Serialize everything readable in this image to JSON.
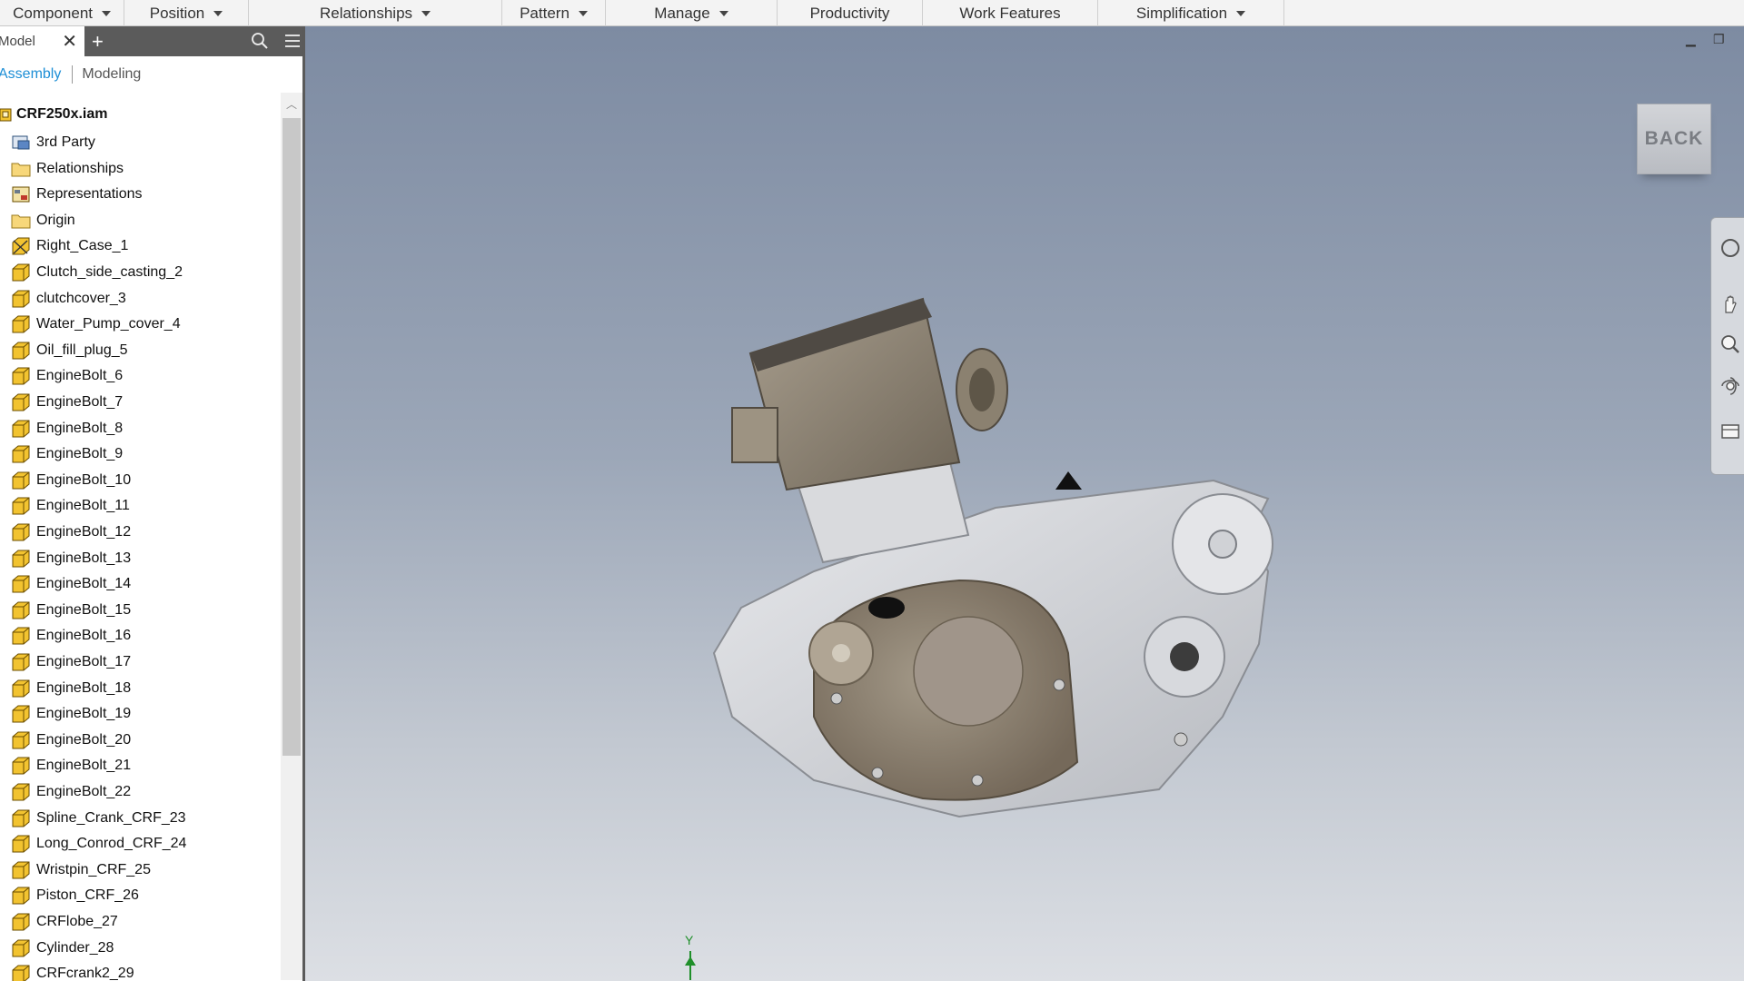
{
  "ribbon": {
    "tabs": [
      {
        "label": "Component",
        "dropdown": true
      },
      {
        "label": "Position",
        "dropdown": true
      },
      {
        "label": "Relationships",
        "dropdown": true
      },
      {
        "label": "Pattern",
        "dropdown": true
      },
      {
        "label": "Manage",
        "dropdown": true
      },
      {
        "label": "Productivity",
        "dropdown": false
      },
      {
        "label": "Work Features",
        "dropdown": false
      },
      {
        "label": "Simplification",
        "dropdown": true
      }
    ]
  },
  "browser": {
    "tab_label": "Model",
    "add_symbol": "+",
    "subtabs": {
      "active": "Assembly",
      "inactive": "Modeling"
    },
    "root": "CRF250x.iam",
    "items": [
      {
        "label": "3rd Party",
        "icon": "third-party-icon"
      },
      {
        "label": "Relationships",
        "icon": "folder-icon"
      },
      {
        "label": "Representations",
        "icon": "representations-icon"
      },
      {
        "label": "Origin",
        "icon": "folder-icon"
      },
      {
        "label": "Right_Case_1",
        "icon": "grounded-part-icon"
      },
      {
        "label": "Clutch_side_casting_2",
        "icon": "part-icon"
      },
      {
        "label": "clutchcover_3",
        "icon": "part-icon"
      },
      {
        "label": "Water_Pump_cover_4",
        "icon": "part-icon"
      },
      {
        "label": "Oil_fill_plug_5",
        "icon": "part-icon"
      },
      {
        "label": "EngineBolt_6",
        "icon": "part-icon"
      },
      {
        "label": "EngineBolt_7",
        "icon": "part-icon"
      },
      {
        "label": "EngineBolt_8",
        "icon": "part-icon"
      },
      {
        "label": "EngineBolt_9",
        "icon": "part-icon"
      },
      {
        "label": "EngineBolt_10",
        "icon": "part-icon"
      },
      {
        "label": "EngineBolt_11",
        "icon": "part-icon"
      },
      {
        "label": "EngineBolt_12",
        "icon": "part-icon"
      },
      {
        "label": "EngineBolt_13",
        "icon": "part-icon"
      },
      {
        "label": "EngineBolt_14",
        "icon": "part-icon"
      },
      {
        "label": "EngineBolt_15",
        "icon": "part-icon"
      },
      {
        "label": "EngineBolt_16",
        "icon": "part-icon"
      },
      {
        "label": "EngineBolt_17",
        "icon": "part-icon"
      },
      {
        "label": "EngineBolt_18",
        "icon": "part-icon"
      },
      {
        "label": "EngineBolt_19",
        "icon": "part-icon"
      },
      {
        "label": "EngineBolt_20",
        "icon": "part-icon"
      },
      {
        "label": "EngineBolt_21",
        "icon": "part-icon"
      },
      {
        "label": "EngineBolt_22",
        "icon": "part-icon"
      },
      {
        "label": "Spline_Crank_CRF_23",
        "icon": "part-icon"
      },
      {
        "label": "Long_Conrod_CRF_24",
        "icon": "part-icon"
      },
      {
        "label": "Wristpin_CRF_25",
        "icon": "part-icon"
      },
      {
        "label": "Piston_CRF_26",
        "icon": "part-icon"
      },
      {
        "label": "CRFlobe_27",
        "icon": "part-icon"
      },
      {
        "label": "Cylinder_28",
        "icon": "part-icon"
      },
      {
        "label": "CRFcrank2_29",
        "icon": "part-icon"
      }
    ]
  },
  "viewport": {
    "viewcube_label": "BACK",
    "axis_label": "Y"
  },
  "colors": {
    "accent": "#1e8fd6",
    "part_icon": "#f2c330",
    "axis_green": "#1f8f2a"
  }
}
